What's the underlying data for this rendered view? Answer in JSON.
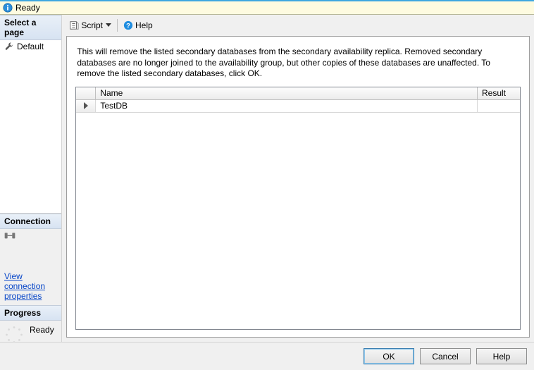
{
  "status": {
    "text": "Ready"
  },
  "left": {
    "select_page_header": "Select a page",
    "pages": [
      {
        "label": "Default"
      }
    ],
    "connection_header": "Connection",
    "view_conn_link": "View connection properties",
    "progress_header": "Progress",
    "progress_text": "Ready"
  },
  "toolbar": {
    "script_label": "Script",
    "help_label": "Help"
  },
  "content": {
    "description": "This will remove the listed secondary databases from the secondary availability replica. Removed secondary databases are no longer joined to the availability group, but other copies of these databases are unaffected. To remove the listed secondary databases, click OK.",
    "columns": {
      "name": "Name",
      "result": "Result"
    },
    "rows": [
      {
        "name": "TestDB",
        "result": ""
      }
    ]
  },
  "buttons": {
    "ok": "OK",
    "cancel": "Cancel",
    "help": "Help"
  }
}
